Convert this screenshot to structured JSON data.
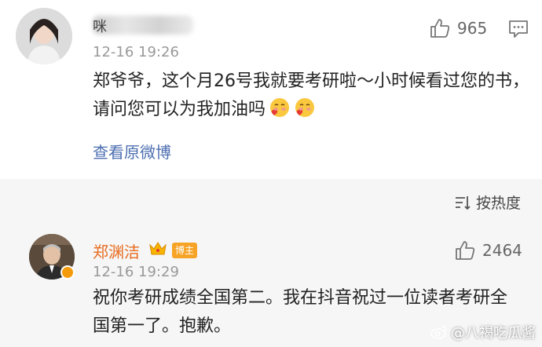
{
  "comment1": {
    "name_prefix": "咪",
    "time": "12-16 19:26",
    "likes": "965",
    "text": "郑爷爷，这个月26号我就要考研啦～小时候看过您的书，请问您可以为我加油吗",
    "view_origin": "查看原微博"
  },
  "sort": {
    "label": "按热度"
  },
  "reply": {
    "author": "郑渊洁",
    "badge": "博主",
    "time": "12-16 19:29",
    "likes": "2464",
    "text": "祝你考研成绩全国第二。我在抖音祝过一位读者考研全国第一了。抱歉。"
  },
  "watermark": "@八褐吃瓜酱",
  "colors": {
    "link": "#4d6fb1",
    "author": "#e86c1f",
    "badge": "#f7a325"
  }
}
